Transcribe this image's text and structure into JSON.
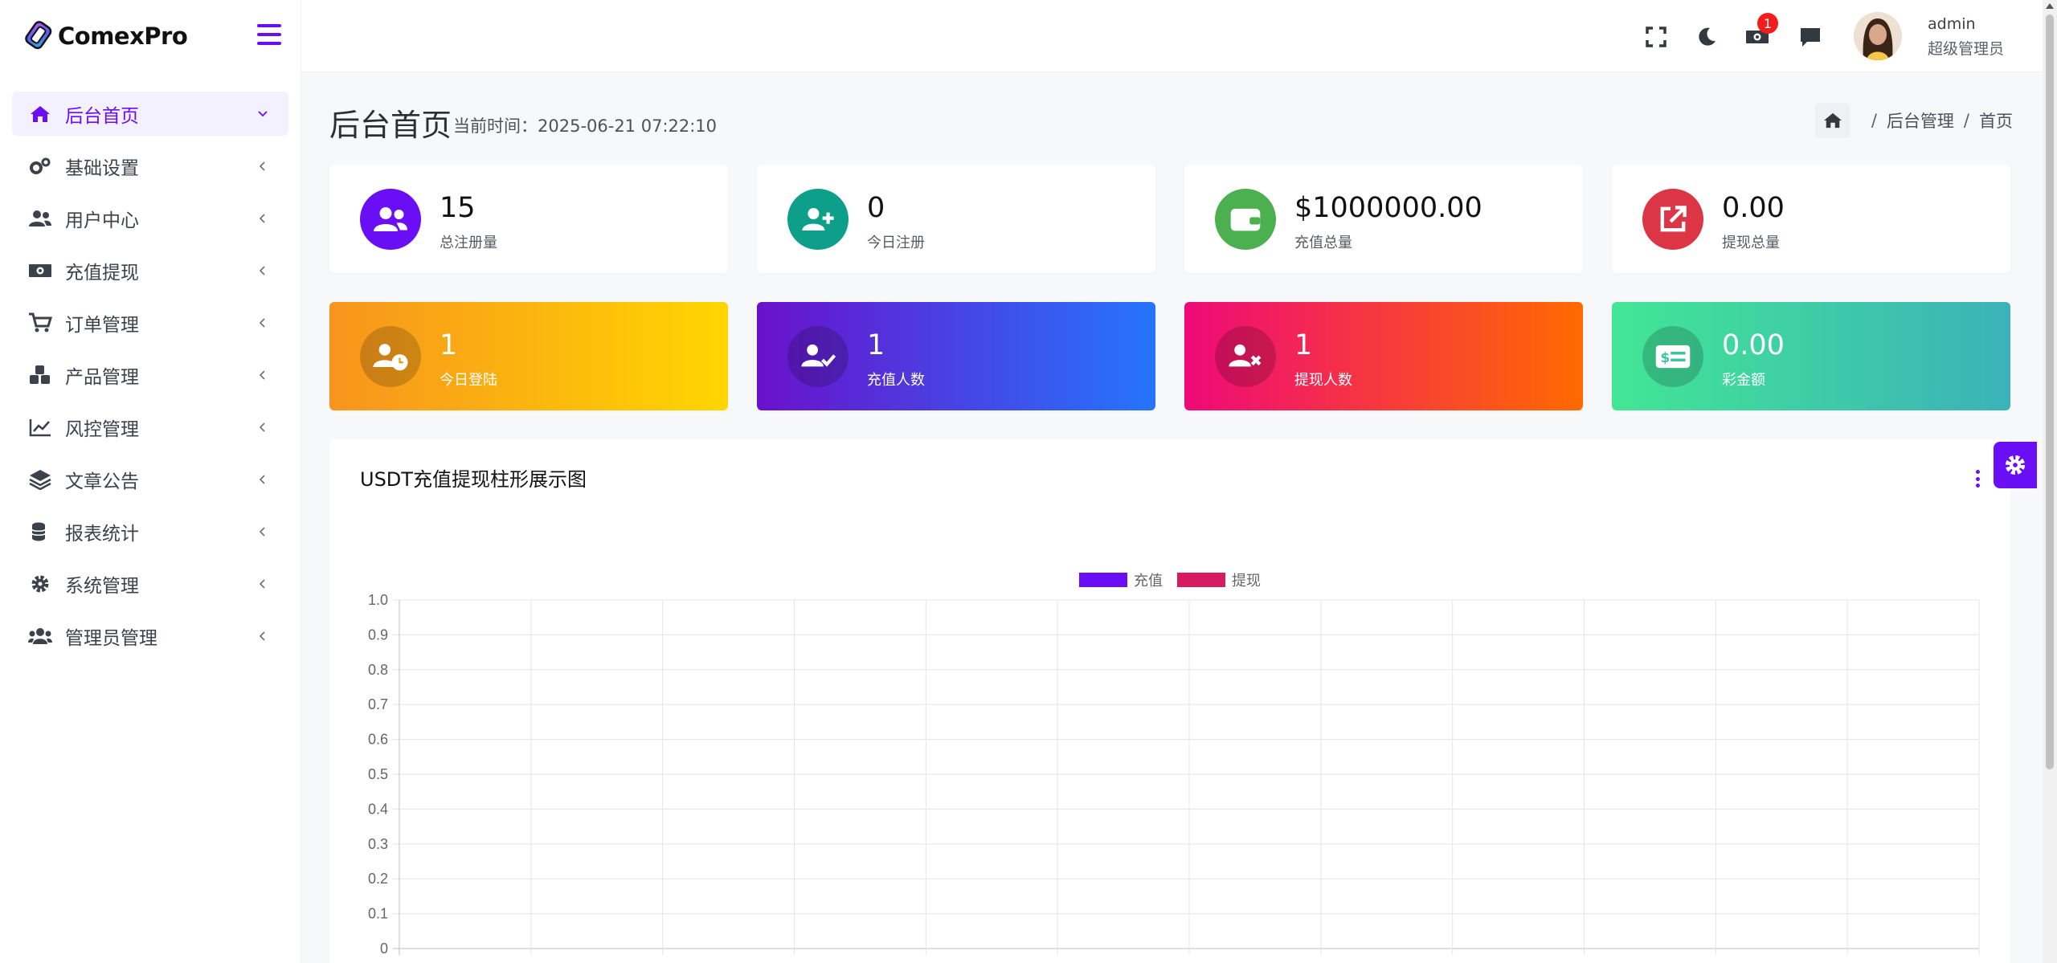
{
  "brand": {
    "name": "ComexPro"
  },
  "sidebar": {
    "items": [
      {
        "label": "后台首页",
        "icon": "home-icon",
        "active": true
      },
      {
        "label": "基础设置",
        "icon": "cogs-icon"
      },
      {
        "label": "用户中心",
        "icon": "users-icon"
      },
      {
        "label": "充值提现",
        "icon": "money-icon"
      },
      {
        "label": "订单管理",
        "icon": "cart-icon"
      },
      {
        "label": "产品管理",
        "icon": "cubes-icon"
      },
      {
        "label": "风控管理",
        "icon": "line-chart-icon"
      },
      {
        "label": "文章公告",
        "icon": "layers-icon"
      },
      {
        "label": "报表统计",
        "icon": "coins-icon"
      },
      {
        "label": "系统管理",
        "icon": "gear-icon"
      },
      {
        "label": "管理员管理",
        "icon": "admins-icon"
      }
    ]
  },
  "header": {
    "notification_count": "1",
    "user_name": "admin",
    "user_role": "超级管理员"
  },
  "page": {
    "title": "后台首页",
    "subtitle": "当前时间：2025-06-21 07:22:10",
    "breadcrumb": [
      "后台管理",
      "首页"
    ]
  },
  "stats_row1": [
    {
      "value": "15",
      "label": "总注册量",
      "icon": "users-icon",
      "color": "#6a0ef5"
    },
    {
      "value": "0",
      "label": "今日注册",
      "icon": "user-plus-icon",
      "color": "#0d9f8a"
    },
    {
      "value": "$1000000.00",
      "label": "充值总量",
      "icon": "wallet-icon",
      "color": "#4caf50"
    },
    {
      "value": "0.00",
      "label": "提现总量",
      "icon": "external-link-icon",
      "color": "#dc3545"
    }
  ],
  "stats_row2": [
    {
      "value": "1",
      "label": "今日登陆",
      "icon": "user-clock-icon",
      "gradient": [
        "#f7941d",
        "#ffd600"
      ]
    },
    {
      "value": "1",
      "label": "充值人数",
      "icon": "user-check-icon",
      "gradient": [
        "#6a11cb",
        "#2575fc"
      ]
    },
    {
      "value": "1",
      "label": "提现人数",
      "icon": "user-times-icon",
      "gradient": [
        "#ee0979",
        "#ff6a00"
      ]
    },
    {
      "value": "0.00",
      "label": "彩金额",
      "icon": "money-check-icon",
      "gradient": [
        "#42e695",
        "#3bb2b8"
      ]
    }
  ],
  "chart_data": {
    "type": "bar",
    "title": "USDT充值提现柱形展示图",
    "categories": [
      "",
      "",
      "",
      "",
      "",
      "",
      "",
      "",
      "",
      "",
      "",
      ""
    ],
    "series": [
      {
        "name": "充值",
        "values": [],
        "color": "#6a0ef5"
      },
      {
        "name": "提现",
        "values": [],
        "color": "#d81b60"
      }
    ],
    "yticks": [
      "1.0",
      "0.9",
      "0.8",
      "0.7",
      "0.6",
      "0.5",
      "0.4",
      "0.3",
      "0.2",
      "0.1",
      "0"
    ],
    "ylim": [
      0,
      1.0
    ],
    "grid": true,
    "legend": "top-center"
  }
}
